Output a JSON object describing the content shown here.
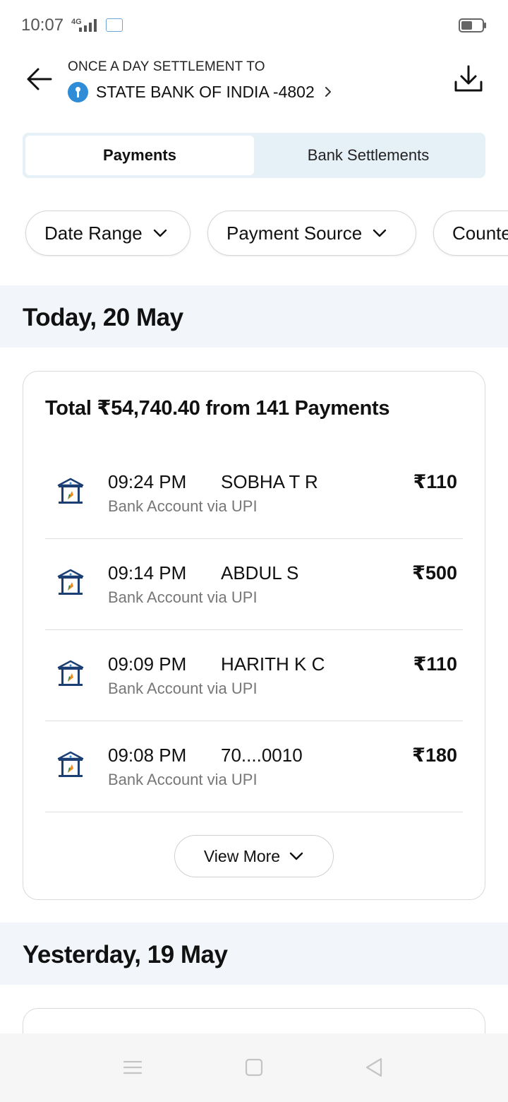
{
  "status_bar": {
    "time": "10:07",
    "network": "4G"
  },
  "header": {
    "settlement_label": "ONCE A DAY SETTLEMENT TO",
    "bank_name": "STATE BANK OF INDIA -4802"
  },
  "tabs": [
    {
      "label": "Payments",
      "active": true
    },
    {
      "label": "Bank Settlements",
      "active": false
    }
  ],
  "filters": [
    {
      "label": "Date Range"
    },
    {
      "label": "Payment Source"
    },
    {
      "label": "Counte"
    }
  ],
  "sections": [
    {
      "title": "Today, 20 May",
      "total": "Total ₹54,740.40 from 141 Payments",
      "transactions": [
        {
          "time": "09:24 PM",
          "name": "SOBHA T R",
          "amount": "₹110",
          "source": "Bank Account via UPI"
        },
        {
          "time": "09:14 PM",
          "name": "ABDUL S",
          "amount": "₹500",
          "source": "Bank Account via UPI"
        },
        {
          "time": "09:09 PM",
          "name": "HARITH K C",
          "amount": "₹110",
          "source": "Bank Account via UPI"
        },
        {
          "time": "09:08 PM",
          "name": "70....0010",
          "amount": "₹180",
          "source": "Bank Account via UPI"
        }
      ],
      "view_more": "View More"
    },
    {
      "title": "Yesterday, 19 May"
    }
  ],
  "colors": {
    "accent_blue": "#2f8cd6",
    "tab_bg": "#e6f0f7",
    "section_bg": "#f2f6fb",
    "bank_icon_navy": "#1c3f73",
    "bank_icon_orange": "#f08a24"
  }
}
